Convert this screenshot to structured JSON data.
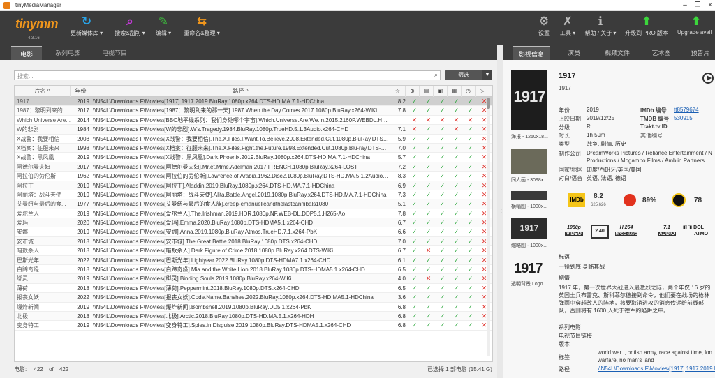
{
  "window": {
    "title": "tinyMediaManager"
  },
  "toolbar": {
    "logo": "tinymm",
    "version": "4.3.16",
    "update": "更新媒体库 ▾",
    "search": "搜索&刮削 ▾",
    "edit": "编辑 ▾",
    "rename": "重命名&整理 ▾",
    "settings": "设置",
    "tools": "工具 ▾",
    "help": "帮助 / 关于 ▾",
    "pro": "升级到 PRO 版本",
    "upgrade": "Upgrade avail"
  },
  "tabs": [
    "电影",
    "系列电影",
    "电视节目"
  ],
  "search": {
    "placeholder": "搜索...",
    "filter": "筛选"
  },
  "table": {
    "headers": {
      "title": "片名 ^",
      "year": "年份",
      "path": "路径 ^"
    },
    "rows": [
      {
        "title": "1917",
        "year": "2019",
        "path": "\\\\N54L\\Downloads F\\Movies\\[1917].1917.2019.BluRay.1080p.x264.DTS-HD.MA.7.1-HDChina",
        "rating": "8.2",
        "checks": [
          1,
          1,
          1,
          1,
          1,
          0
        ]
      },
      {
        "title": "1987：黎明到来的...",
        "year": "2017",
        "path": "\\\\N54L\\Downloads F\\Movies\\[1987：黎明到来的那一天].1987.When.the.Day.Comes.2017.1080p.BluRay.x264-WiKi",
        "rating": "7.8",
        "checks": [
          1,
          1,
          1,
          1,
          1,
          0
        ]
      },
      {
        "title": "Which Universe Are...",
        "year": "2014",
        "path": "\\\\N54L\\Downloads F\\Movies\\[BBC地平线系列：我们身处哪个宇宙].Which.Universe.Are.We.In.2015.2160P.WEBDL.HEVC",
        "rating": "",
        "checks": [
          0,
          0,
          0,
          0,
          0,
          0
        ]
      },
      {
        "title": "W的悲剧",
        "year": "1984",
        "path": "\\\\N54L\\Downloads F\\Movies\\[W的悲剧].W's.Tragedy.1984.BluRay.1080p.TrueHD.5.1.3Audio.x264-CHD",
        "rating": "7.1",
        "checks": [
          0,
          1,
          1,
          0,
          1,
          0
        ]
      },
      {
        "title": "X战警：我要相信",
        "year": "2008",
        "path": "\\\\N54L\\Downloads F\\Movies\\[X战警：我要相信].The.X.Files.I.Want.To.Believe.2008.Extended.Cut.1080p.BluRay.DTS-HD.MA.5.1",
        "rating": "5.9",
        "checks": [
          1,
          1,
          1,
          1,
          1,
          0
        ]
      },
      {
        "title": "X档案：征服未来",
        "year": "1998",
        "path": "\\\\N54L\\Downloads F\\Movies\\[X档案：征服未来].The.X.Files.Fight.the.Future.1998.Extended.Cut.1080p.Blu-ray.DTS-HD.MA.5.1",
        "rating": "7.0",
        "checks": [
          1,
          1,
          1,
          1,
          1,
          0
        ]
      },
      {
        "title": "X战警：黑凤凰",
        "year": "2019",
        "path": "\\\\N54L\\Downloads F\\Movies\\[X战警：黑凤凰].Dark.Phoenix.2019.BluRay.1080p.x264.DTS-HD.MA.7.1-HDChina",
        "rating": "5.7",
        "checks": [
          1,
          1,
          1,
          1,
          1,
          0
        ]
      },
      {
        "title": "阿德尔曼夫妇",
        "year": "2017",
        "path": "\\\\N54L\\Downloads F\\Movies\\[阿德尔曼夫妇].Mr.et.Mme.Adelman.2017.FRENCH.1080p.BluRay.x264-LOST",
        "rating": "7.2",
        "checks": [
          1,
          1,
          1,
          1,
          1,
          0
        ]
      },
      {
        "title": "阿拉伯的劳伦斯",
        "year": "1962",
        "path": "\\\\N54L\\Downloads F\\Movies\\[阿拉伯的劳伦斯].Lawrence.of.Arabia.1962.Disc2.1080p.BluRay.DTS-HD.MA.5.1.2Audio.x264-CHD",
        "rating": "8.3",
        "checks": [
          1,
          1,
          1,
          1,
          1,
          0
        ]
      },
      {
        "title": "阿拉丁",
        "year": "2019",
        "path": "\\\\N54L\\Downloads F\\Movies\\[阿拉丁].Aladdin.2019.BluRay.1080p.x264.DTS-HD.MA.7.1-HDChina",
        "rating": "6.9",
        "checks": [
          1,
          1,
          1,
          1,
          1,
          0
        ]
      },
      {
        "title": "阿丽塔：战斗天使",
        "year": "2019",
        "path": "\\\\N54L\\Downloads F\\Movies\\[阿丽塔：战斗天使].Alita.Battle.Angel.2019.1080p.BluRay.x264.DTS-HD.MA.7.1-HDChina",
        "rating": "7.3",
        "checks": [
          1,
          1,
          1,
          1,
          1,
          0
        ]
      },
      {
        "title": "艾曼纽与最后的食...",
        "year": "1977",
        "path": "\\\\N54L\\Downloads F\\Movies\\[艾曼纽与最后的食人族].creep-emanuelleandthelastcannibals1080",
        "rating": "5.1",
        "checks": [
          1,
          1,
          1,
          1,
          1,
          0
        ]
      },
      {
        "title": "爱尔兰人",
        "year": "2019",
        "path": "\\\\N54L\\Downloads F\\Movies\\[爱尔兰人].The.Irishman.2019.HDR.1080p.NF.WEB-DL.DDP5.1.H265-Ao",
        "rating": "7.8",
        "checks": [
          1,
          1,
          1,
          1,
          1,
          0
        ]
      },
      {
        "title": "爱玛",
        "year": "2020",
        "path": "\\\\N54L\\Downloads F\\Movies\\[爱玛].Emma.2020.BluRay.1080p.DTS-HDMA5.1.x264-CHD",
        "rating": "6.7",
        "checks": [
          1,
          1,
          1,
          1,
          1,
          0
        ]
      },
      {
        "title": "安娜",
        "year": "2019",
        "path": "\\\\N54L\\Downloads F\\Movies\\[安娜].Anna.2019.1080p.BluRay.Atmos.TrueHD.7.1.x264-PbK",
        "rating": "6.6",
        "checks": [
          1,
          1,
          1,
          1,
          1,
          0
        ]
      },
      {
        "title": "安市城",
        "year": "2018",
        "path": "\\\\N54L\\Downloads F\\Movies\\[安市城].The.Great.Battle.2018.BluRay.1080p.DTS.x264-CHD",
        "rating": "7.0",
        "checks": [
          1,
          1,
          1,
          1,
          1,
          0
        ]
      },
      {
        "title": "暗数杀人",
        "year": "2018",
        "path": "\\\\N54L\\Downloads F\\Movies\\[暗数杀人].Dark.Figure.of.Crime.2018.1080p.BluRay.x264.DTS-WiKi",
        "rating": "6.7",
        "checks": [
          1,
          0,
          1,
          1,
          1,
          0
        ]
      },
      {
        "title": "巴斯光年",
        "year": "2022",
        "path": "\\\\N54L\\Downloads F\\Movies\\[巴斯光年].Lightyear.2022.BluRay.1080p.DTS-HDMA7.1.x264-CHD",
        "rating": "6.1",
        "checks": [
          1,
          1,
          1,
          1,
          1,
          0
        ]
      },
      {
        "title": "白蹄奇缘",
        "year": "2018",
        "path": "\\\\N54L\\Downloads F\\Movies\\[白蹄奇缘].Mia.and.the.White.Lion.2018.BluRay.1080p.DTS-HDMA5.1.x264-CHD",
        "rating": "6.5",
        "checks": [
          1,
          1,
          1,
          1,
          1,
          0
        ]
      },
      {
        "title": "绑灵",
        "year": "2019",
        "path": "\\\\N54L\\Downloads F\\Movies\\[绑灵].Binding.Souls.2019.1080p.BluRay.x264-WiKi",
        "rating": "4.0",
        "checks": [
          1,
          0,
          1,
          1,
          1,
          0
        ]
      },
      {
        "title": "薄荷",
        "year": "2018",
        "path": "\\\\N54L\\Downloads F\\Movies\\[薄荷].Peppermint.2018.BluRay.1080p.DTS.x264-CHD",
        "rating": "6.5",
        "checks": [
          1,
          1,
          1,
          1,
          1,
          0
        ]
      },
      {
        "title": "报丧女妖",
        "year": "2022",
        "path": "\\\\N54L\\Downloads F\\Movies\\[报丧女妖].Code.Name.Banshee.2022.BluRay.1080p.x264.DTS-HD.MA5.1-HDChina",
        "rating": "3.6",
        "checks": [
          1,
          1,
          1,
          1,
          1,
          0
        ]
      },
      {
        "title": "爆炸新闻",
        "year": "2019",
        "path": "\\\\N54L\\Downloads F\\Movies\\[爆炸新闻].Bombshell.2019.1080p.BluRay.DD5.1.x264-PbK",
        "rating": "6.8",
        "checks": [
          1,
          1,
          1,
          1,
          1,
          0
        ]
      },
      {
        "title": "北极",
        "year": "2018",
        "path": "\\\\N54L\\Downloads F\\Movies\\[北极].Arctic.2018.BluRay.1080p.DTS-HD.MA.5.1.x264-HDH",
        "rating": "6.8",
        "checks": [
          1,
          1,
          1,
          1,
          1,
          0
        ]
      },
      {
        "title": "变身特工",
        "year": "2019",
        "path": "\\\\N54L\\Downloads F\\Movies\\[变身特工].Spies.in.Disguise.2019.1080p.BluRay.DTS-HDMA5.1.x264-CHD",
        "rating": "6.8",
        "checks": [
          1,
          1,
          1,
          1,
          1,
          0
        ]
      }
    ]
  },
  "status": {
    "count_label": "电影:",
    "count": "422",
    "of": "of",
    "total": "422",
    "selected": "已选择 1 部电影 (15.41 G)"
  },
  "detail": {
    "tabs": [
      "影视信息",
      "演员",
      "视频文件",
      "艺术图",
      "预告片"
    ],
    "poster_text": "1917",
    "title": "1917",
    "subtitle": "1917",
    "captions": [
      "海报 - 1250x18...",
      "同人画 - 3098x...",
      "横幅图 - 1000x...",
      "缩略图 - 1000x...",
      "透明背景 Logo ..."
    ],
    "meta": [
      {
        "k": "年份",
        "v": "2019"
      },
      {
        "k": "上映日期",
        "v": "2019/12/25"
      },
      {
        "k": "分级",
        "v": "R"
      },
      {
        "k": "时长",
        "v": "1h 59m"
      },
      {
        "k": "类型",
        "v": "战争, 剧情, 历史"
      }
    ],
    "ids": [
      {
        "k": "IMDb 编号",
        "v": "tt8579674"
      },
      {
        "k": "TMDB 编号",
        "v": "530915"
      },
      {
        "k": "Trakt.tv ID",
        "v": ""
      },
      {
        "k": "其他编号",
        "v": ""
      }
    ],
    "company_label": "制作公司",
    "company": "DreamWorks Pictures / Reliance Entertainment / N",
    "company2": "Productions / Mogambo Films / Amblin Partners",
    "country_label": "国家/地区",
    "country": "印度/西班牙/英国/美国",
    "lang_label": "对白/语音",
    "lang": "英语, 法语, 德语",
    "imdb_score": "8.2",
    "imdb_votes": "625,626",
    "tomato": "89%",
    "metacritic": "78",
    "badges": [
      "1080p VIDEO",
      "2.40",
      "H.264 MPEG-4/AVC",
      "7.1 AUDIO",
      "DOLBY ATMOS"
    ],
    "tagline_label": "标语",
    "tagline": "一镜到底 身临其战",
    "plot_label": "剧情",
    "plot": "1917 年，第一次世界大战进入最激烈之际，两个年仅 16 岁的英国士兵布雷克、斯科菲尔德接到命令，他们要在战场的枪林弹雨中穿越敌人的阵地，将要取消进攻的消息传递给前线部队，否则将有 1600 人死于德军的陷阱之中。",
    "set_label": "系列电影",
    "tvlink_label": "电视节目链接",
    "edition_label": "版本",
    "tags_label": "标签",
    "tags": "world war i, british army, race against time, lon",
    "tags2": "warfare, no man's land",
    "path_label": "路径",
    "path": "\\\\N54L\\Downloads F\\Movies\\[1917].1917.2019.Bl"
  },
  "colors": {
    "accent": "#f0961c",
    "ok": "#2aa63a",
    "no": "#e0302a",
    "toolbar": "#3b3b3b"
  }
}
